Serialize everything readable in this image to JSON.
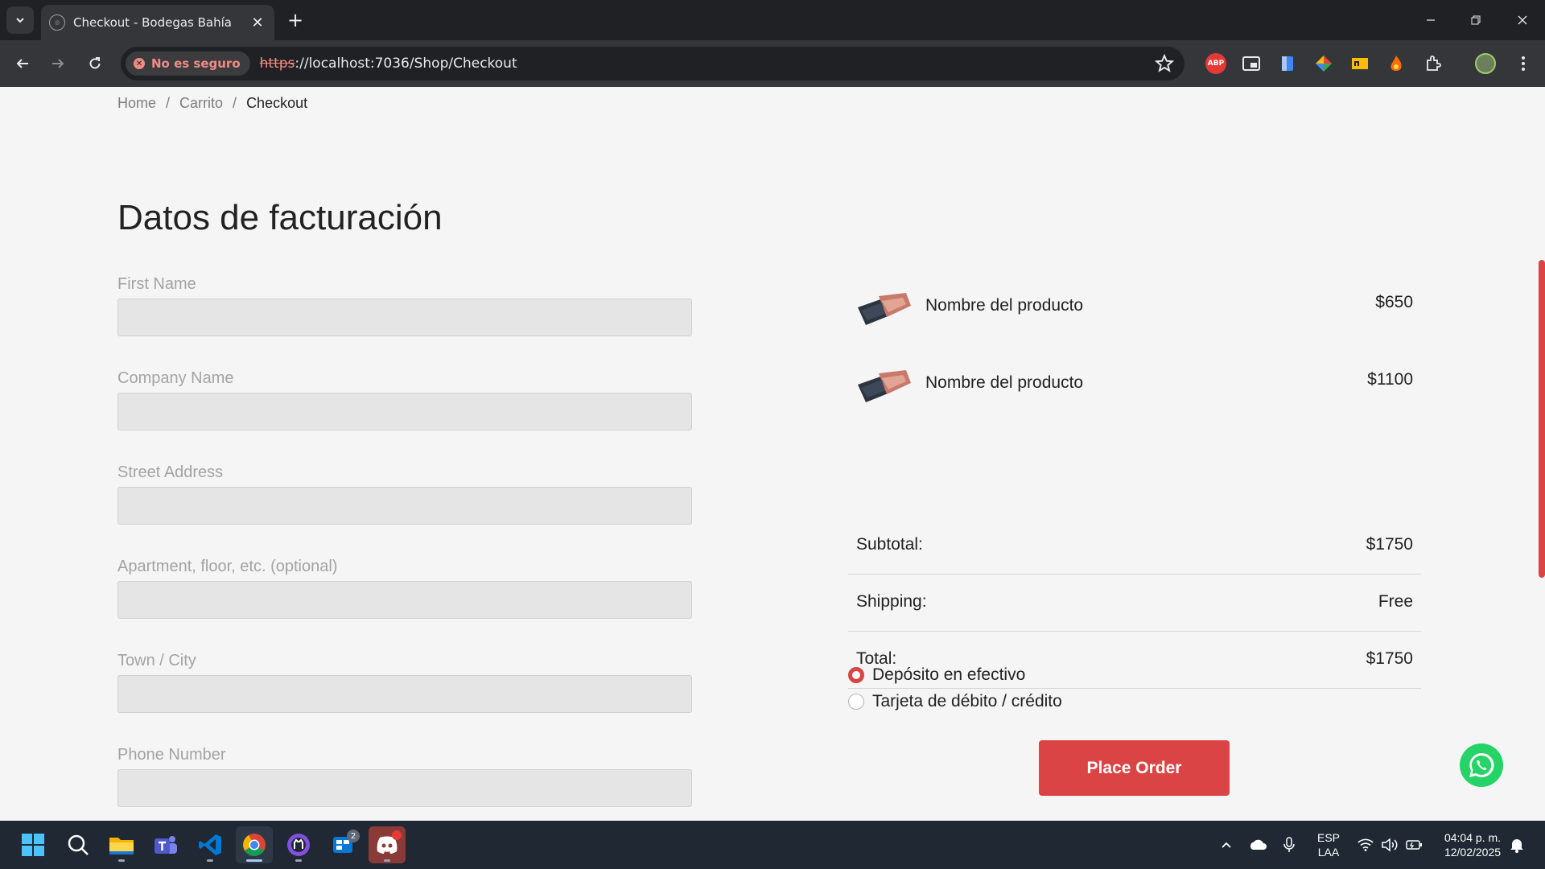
{
  "browser": {
    "tab_title": "Checkout - Bodegas Bahía",
    "security_label": "No es seguro",
    "url_scheme": "https",
    "url_rest": "://localhost:7036/Shop/Checkout",
    "extensions": [
      {
        "name": "adblock-plus-icon",
        "label": "ABP",
        "color": "#e53935"
      },
      {
        "name": "picture-in-picture-icon",
        "label": "",
        "color": "#5f6368"
      },
      {
        "name": "docs-extension-icon",
        "label": "",
        "color": "#4285f4"
      },
      {
        "name": "color-picker-icon",
        "label": "",
        "color": "#34a853"
      },
      {
        "name": "yellow-extension-icon",
        "label": "",
        "color": "#fbbc04"
      },
      {
        "name": "fire-extension-icon",
        "label": "",
        "color": "#ff6d00"
      }
    ]
  },
  "breadcrumb": {
    "home": "Home",
    "sep1": "/",
    "cart": "Carrito",
    "sep2": "/",
    "current": "Checkout"
  },
  "billing": {
    "title": "Datos de facturación",
    "fields": [
      {
        "label": "First Name",
        "value": ""
      },
      {
        "label": "Company Name",
        "value": ""
      },
      {
        "label": "Street Address",
        "value": ""
      },
      {
        "label": "Apartment, floor, etc. (optional)",
        "value": ""
      },
      {
        "label": "Town / City",
        "value": ""
      },
      {
        "label": "Phone Number",
        "value": ""
      }
    ]
  },
  "order": {
    "products": [
      {
        "name": "Nombre del producto",
        "price": "$650"
      },
      {
        "name": "Nombre del producto",
        "price": "$1100"
      }
    ],
    "summary": [
      {
        "label": "Subtotal:",
        "value": "$1750"
      },
      {
        "label": "Shipping:",
        "value": "Free"
      },
      {
        "label": "Total:",
        "value": "$1750"
      }
    ],
    "payment_methods": [
      {
        "label": "Depósito en efectivo",
        "checked": true
      },
      {
        "label": "Tarjeta de débito / crédito",
        "checked": false
      }
    ],
    "place_order_label": "Place Order",
    "accent_color": "#db4444"
  },
  "taskbar": {
    "apps": [
      "windows-start-icon",
      "search-icon",
      "file-explorer-icon",
      "teams-icon",
      "vscode-icon",
      "chrome-icon",
      "github-desktop-icon",
      "windows-app-icon",
      "discord-icon"
    ],
    "windows_app_badge": "2",
    "language": "ESP",
    "layout": "LAA",
    "time": "04:04 p. m.",
    "date": "12/02/2025"
  }
}
